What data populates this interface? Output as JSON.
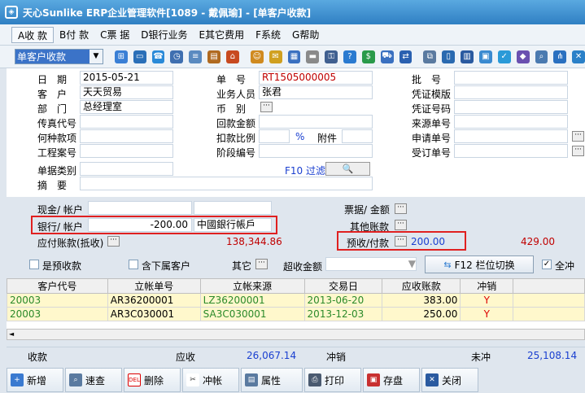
{
  "titlebar": {
    "title": "天心Sunlike ERP企业管理软件[1089 - 戴佩瑜] - [单客户收款]"
  },
  "menu": [
    {
      "label": "A收 款"
    },
    {
      "label": "B付 款"
    },
    {
      "label": "C票 据"
    },
    {
      "label": "D银行业务"
    },
    {
      "label": "E其它费用"
    },
    {
      "label": "F系统"
    },
    {
      "label": "G帮助"
    }
  ],
  "toolbar": {
    "doc_type": "单客户收款"
  },
  "form": {
    "date_label": "日　期",
    "date_value": "2015-05-21",
    "customer_label": "客　户",
    "customer_value": "天天贸易",
    "dept_label": "部　门",
    "dept_value": "总经理室",
    "fax_label": "传真代号",
    "fax_value": "",
    "reason_label": "何种款项",
    "reason_value": "",
    "project_label": "工程案号",
    "project_value": "",
    "doctype_label": "单据类别",
    "doctype_value": "",
    "summary_label": "摘　要",
    "summary_value": "",
    "docno_label": "单　号",
    "docno_value": "RT1505000005",
    "salesman_label": "业务人员",
    "salesman_value": "张君",
    "currency_label": "币　别",
    "currency_value": "",
    "refund_label": "回款金额",
    "refund_value": "",
    "discount_label": "扣款比例",
    "discount_unit": "%",
    "attach_label": "附件",
    "stage_label": "阶段编号",
    "stage_value": "",
    "filter_label": "F10 过滤",
    "batch_label": "批　号",
    "batch_value": "",
    "template_label": "凭证模版",
    "template_value": "",
    "voucher_label": "凭证号码",
    "voucher_value": "",
    "source_label": "来源单号",
    "source_value": "",
    "apply_label": "申请单号",
    "apply_value": "",
    "order_label": "受订单号",
    "order_value": ""
  },
  "cash": {
    "cash_label": "现金/ 帐户",
    "cash_amount": "",
    "cash_account": "",
    "bank_label": "银行/ 帐户",
    "bank_amount": "-200.00",
    "bank_account": "中國銀行帳戶",
    "receivable_label": "应付账款(抵收)",
    "receivable_amount": "138,344.86",
    "bill_label": "票据/ 金额",
    "other_label": "其他账款",
    "prepay_label": "预收/付款",
    "prepay_amount": "200.00",
    "prepay_balance": "429.00"
  },
  "options": {
    "prepay_check": "是预收款",
    "subsidiary_check": "含下属客户",
    "other_label": "其它",
    "over_label": "超收金额",
    "column_switch": "F12 栏位切换",
    "full_offset": "全冲"
  },
  "grid": {
    "columns": [
      "客户代号",
      "立帐单号",
      "立帐来源",
      "交易日",
      "应收账款",
      "冲销"
    ],
    "rows": [
      [
        "20003",
        "AR36200001",
        "LZ36200001",
        "2013-06-20",
        "383.00",
        "Y"
      ],
      [
        "20003",
        "AR3C030001",
        "SA3C030001",
        "2013-12-03",
        "250.00",
        "Y"
      ]
    ]
  },
  "footer": {
    "received_label": "收款",
    "due_label": "应收",
    "due_value": "26,067.14",
    "offset_label": "冲销",
    "unoffset_label": "未冲",
    "unoffset_value": "25,108.14"
  },
  "buttons": [
    {
      "label": "新增"
    },
    {
      "label": "速查"
    },
    {
      "label": "删除"
    },
    {
      "label": "冲帐"
    },
    {
      "label": "属性"
    },
    {
      "label": "打印"
    },
    {
      "label": "存盘"
    },
    {
      "label": "关闭"
    }
  ],
  "colors": {
    "title_bg": "#3a8ad0",
    "highlight": "#e02020",
    "grid_row": "#fff8cc"
  }
}
